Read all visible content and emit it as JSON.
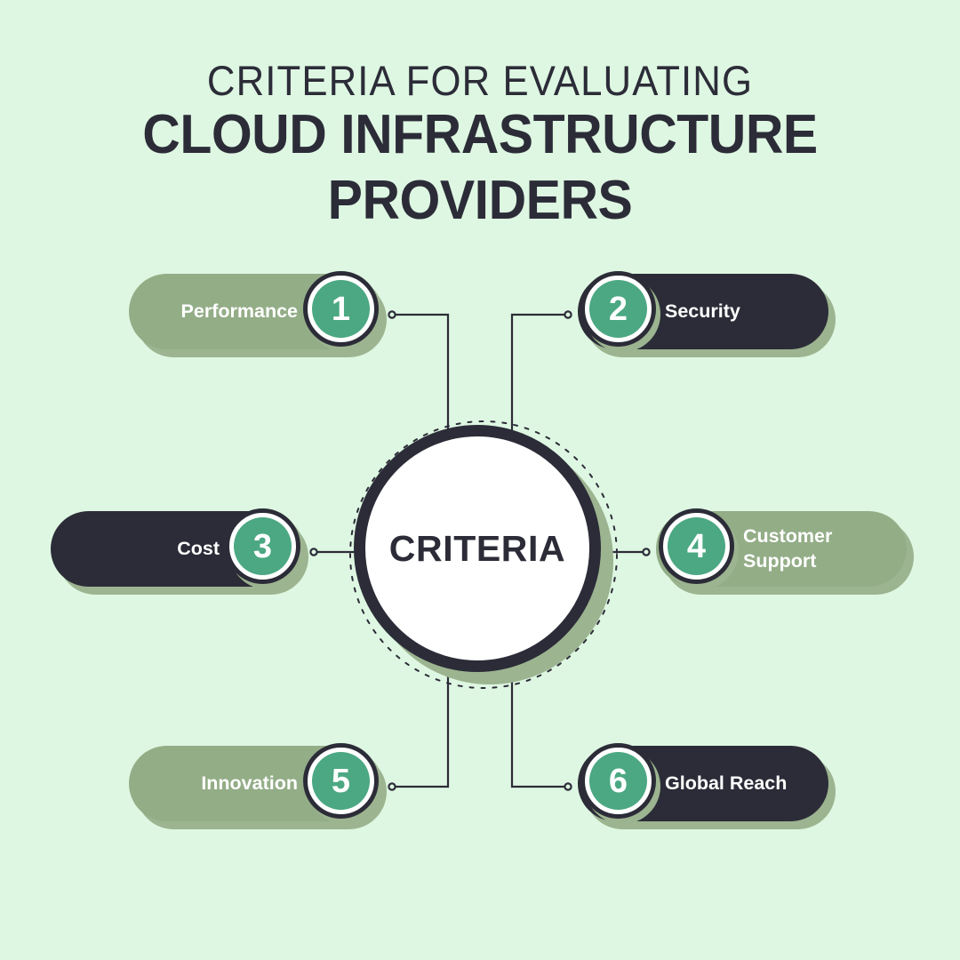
{
  "title": {
    "line1": "CRITERIA FOR EVALUATING",
    "line2": "CLOUD INFRASTRUCTURE PROVIDERS"
  },
  "center": {
    "label": "CRITERIA"
  },
  "nodes": [
    {
      "number": "1",
      "label": "Performance",
      "theme": "sage",
      "side": "left"
    },
    {
      "number": "2",
      "label": "Security",
      "theme": "dark",
      "side": "right"
    },
    {
      "number": "3",
      "label": "Cost",
      "theme": "dark",
      "side": "left"
    },
    {
      "number": "4",
      "label": "Customer\nSupport",
      "theme": "sage",
      "side": "right"
    },
    {
      "number": "5",
      "label": "Innovation",
      "theme": "sage",
      "side": "left"
    },
    {
      "number": "6",
      "label": "Global Reach",
      "theme": "dark",
      "side": "right"
    }
  ],
  "colors": {
    "background": "#def7e2",
    "sage": "#93ad87",
    "shadow": "#9cb490",
    "dark": "#2c2c38",
    "teal": "#4ba882",
    "white": "#ffffff"
  }
}
